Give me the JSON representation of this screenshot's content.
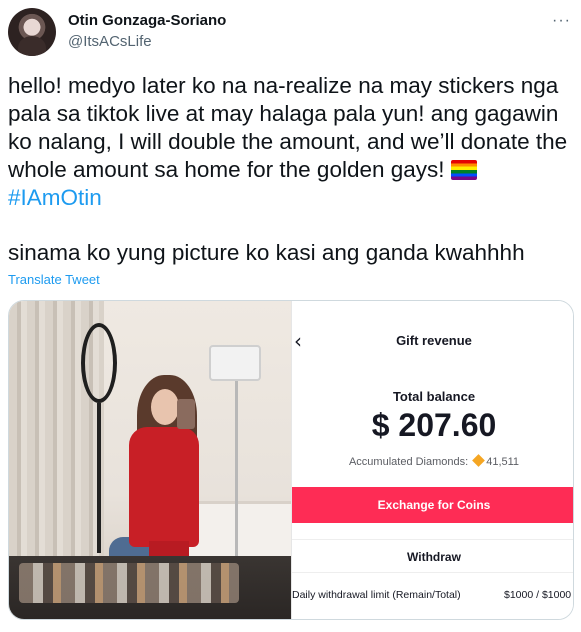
{
  "author": {
    "name": "Otin Gonzaga-Soriano",
    "handle": "@ItsACsLife"
  },
  "tweet": {
    "text_line1": "hello! medyo later ko na na-realize na may stickers nga pala sa tiktok live at may halaga pala yun! ang gagawin ko nalang, I will double the amount, and we’ll donate the whole amount sa home for the golden gays!",
    "hashtag": "#IAmOtin",
    "text_line2": "sinama ko yung picture ko kasi ang ganda kwahhhh",
    "translate_label": "Translate Tweet",
    "flag_icon": "rainbow-flag-icon"
  },
  "screenshot": {
    "title": "Gift revenue",
    "total_label": "Total balance",
    "amount": "$ 207.60",
    "diamonds_label": "Accumulated Diamonds:",
    "diamonds_value": "41,511",
    "exchange_label": "Exchange for Coins",
    "withdraw_label": "Withdraw",
    "limit_label": "Daily withdrawal limit (Remain/Total)",
    "limit_value": "$1000 / $1000",
    "accent_color": "#fe2c55"
  },
  "colors": {
    "link": "#1d9bf0",
    "text": "#0f1419",
    "secondary": "#536471"
  }
}
